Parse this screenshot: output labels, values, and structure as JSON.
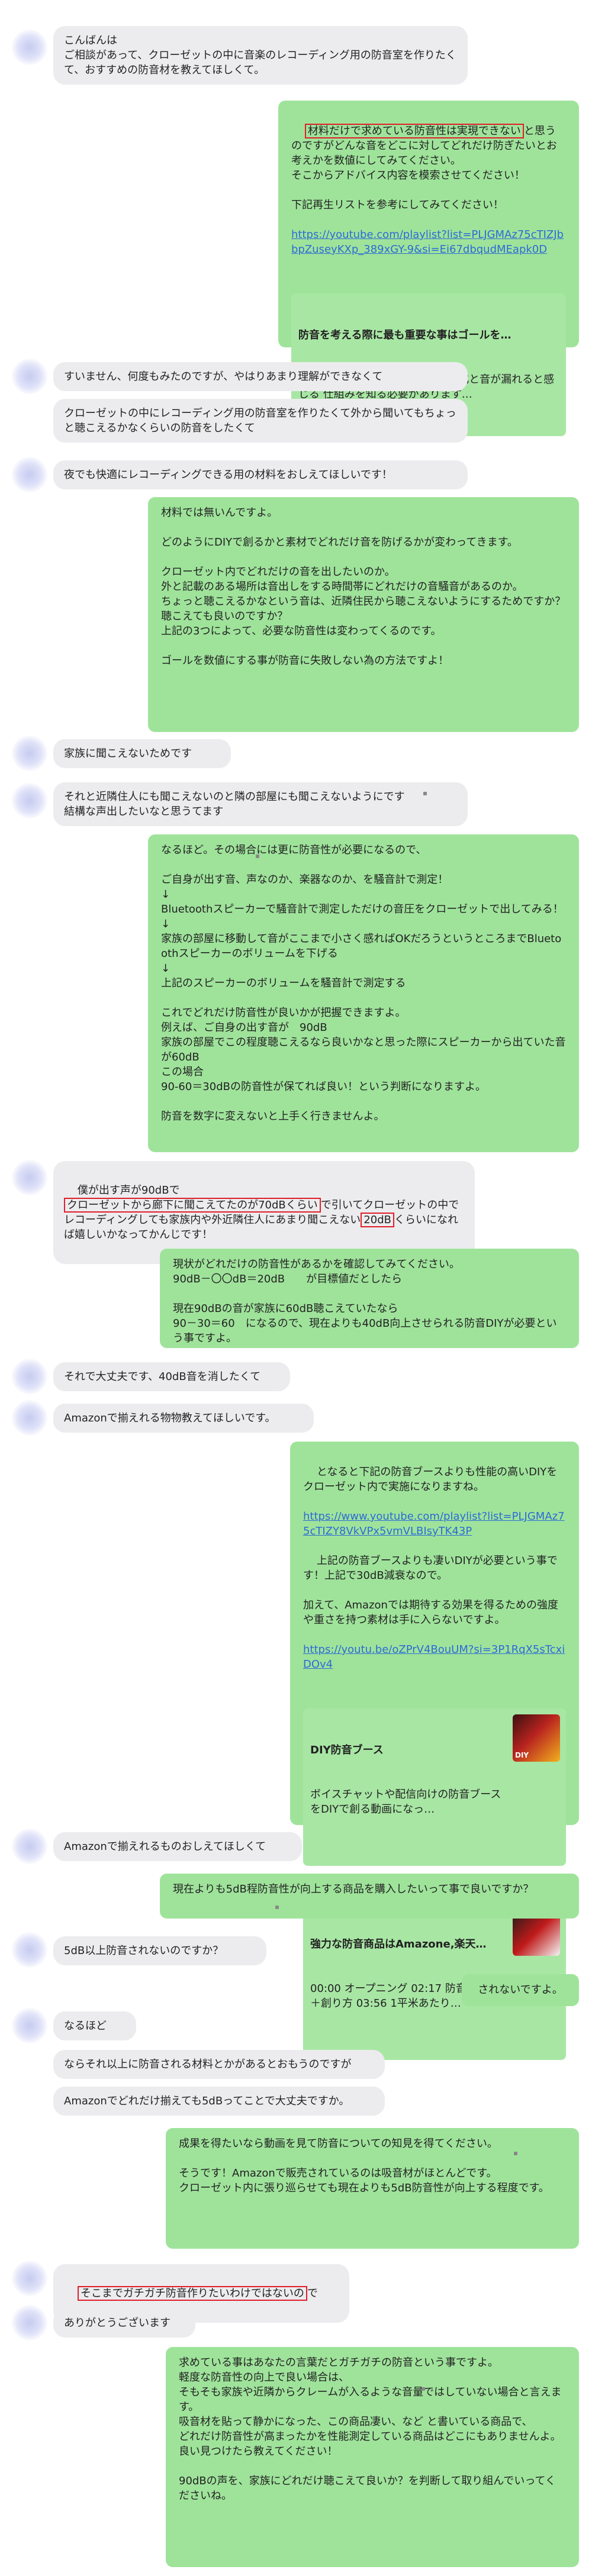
{
  "messages": [
    {
      "side": "in",
      "text": "こんばんは\nご相談があって、クローゼットの中に音楽のレコーディング用の防音室を作りたくて、おすすめの防音材を教えてほしくて。"
    },
    {
      "side": "out",
      "hl": "材料だけで求めている防音性は実現できない",
      "text": "と思うのですがどんな音をどこに対してどれだけ防ぎたいとお考えかを数値にしてみてください。\nそこからアドバイス内容を模索させてください！\n\n下記再生リストを参考にしてみてください！",
      "link": "https://youtube.com/playlist?list=PLJGMAz75cTIZJbbpZuseyKXp_389xGY-9&si=Ei67dbqudMEapk0D",
      "card": {
        "title": "防音を考える際に最も重要な事はゴールを…",
        "desc": "防音にはゴールを明確にする数値化と音が漏れると感じる 仕組みを知る必要があります…"
      }
    },
    {
      "side": "in",
      "text": "すいません、何度もみたのですが、やはりあまり理解ができなくて"
    },
    {
      "side": "in",
      "text": "クローゼットの中にレコーディング用の防音室を作りたくて外から聞いてもちょっと聴こえるかなくらいの防音をしたくて"
    },
    {
      "side": "in",
      "text": "夜でも快適にレコーディングできる用の材料をおしえてほしいです！"
    },
    {
      "side": "out",
      "text": "材料では無いんですよ。\n\nどのようにDIYで創るかと素材でどれだけ音を防げるかが変わってきます。\n\nクローゼット内でどれだけの音を出したいのか。\n外と記載のある場所は音出しをする時間帯にどれだけの音騒音があるのか。\nちょっと聴こえるかなという音は、近隣住民から聴こえないようにするためですか？\n聴こえても良いのですか？\n上記の3つによって、必要な防音性は変わってくるのです。\n\nゴールを数値にする事が防音に失敗しない為の方法ですよ！"
    },
    {
      "side": "in",
      "text": "家族に聞こえないためです"
    },
    {
      "side": "in",
      "text": "それと近隣住人にも聞こえないのと隣の部屋にも聞こえないようにです\n結構な声出したいなと思うてます"
    },
    {
      "side": "out",
      "text": "なるほど。その場合には更に防音性が必要になるので、\n\nご自身が出す音、声なのか、楽器なのか、を騒音計で測定！\n↓\nBluetoothスピーカーで騒音計で測定しただけの音圧をクローゼットで出してみる！\n↓\n家族の部屋に移動して音がここまで小さく感ればOKだろうというところまでBluetoothスピーカーのボリュームを下げる\n↓\n上記のスピーカーのボリュームを騒音計で測定する\n\nこれでどれだけ防音性が良いかが把握できますよ。\n例えば、ご自身の出す音が　90dB\n家族の部屋でこの程度聴こえるなら良いかなと思った際にスピーカーから出ていた音が60dB\nこの場合\n90-60＝30dBの防音性が保てれば良い！という判断になりますよ。\n\n防音を数字に変えないと上手く行きませんよ。"
    },
    {
      "side": "in",
      "parts": [
        {
          "t": "僕が出す声が90dBで\n"
        },
        {
          "t": "クローゼットから廊下に聞こえてたのが70dBくらい",
          "hl": true
        },
        {
          "t": "で引いてクローゼットの中でレコーディングしても家族内や外近隣住人にあまり聞こえない"
        },
        {
          "t": "20dB",
          "hl": true
        },
        {
          "t": "くらいになれば嬉しいかなってかんじです！"
        }
      ]
    },
    {
      "side": "out",
      "text": "現状がどれだけの防音性があるかを確認してみてください。\n90dB－〇〇dB＝20dB　　が目標値だとしたら\n\n現在90dBの音が家族に60dB聴こえていたなら\n90－30＝60　になるので、現在よりも40dB向上させられる防音DIYが必要という事ですよ。"
    },
    {
      "side": "in",
      "text": "それで大丈夫です、40dB音を消したくて"
    },
    {
      "side": "in",
      "text": "Amazonで揃えれる物物教えてほしいです。"
    },
    {
      "side": "out",
      "text": "となると下記の防音ブースよりも性能の高いDIYをクローゼット内で実施になりますね。",
      "link": "https://www.youtube.com/playlist?list=PLJGMAz75cTIZY8VkVPx5vmVLBIsyTK43P",
      "text2": "上記の防音ブースよりも凄いDIYが必要という事です！上記で30dB減衰なので。\n\n加えて、Amazonでは期待する効果を得るための強度や重さを持つ素材は手に入らないですよ。",
      "link2": "https://youtu.be/oZPrV4BouUM?si=3P1RqX5sTcxiDOv4",
      "cards": [
        {
          "title": "DIY防音ブース",
          "desc": "ボイスチャットや配信向けの防音ブースをDIYで創る動画になっ…",
          "thumb": "DIY"
        },
        {
          "title": "強力な防音商品はAmazone,楽天…",
          "desc": "00:00 オープニング 02:17 防音は重さ＋創り方 03:56 1平米あたり…",
          "thumb": ""
        }
      ]
    },
    {
      "side": "in",
      "text": "Amazonで揃えれるものおしえてほしくて"
    },
    {
      "side": "out",
      "text": "現在よりも5dB程防音性が向上する商品を購入したいって事で良いですか？"
    },
    {
      "side": "in",
      "text": "5dB以上防音されないのですか？"
    },
    {
      "side": "out",
      "text": "されないですよ。"
    },
    {
      "side": "in",
      "text": "なるほど"
    },
    {
      "side": "in",
      "text": "ならそれ以上に防音される材料とかがあるとおもうのですが"
    },
    {
      "side": "in",
      "text": "Amazonでどれだけ揃えても5dBってことで大丈夫ですか。"
    },
    {
      "side": "out",
      "text": "成果を得たいなら動画を見て防音についての知見を得てください。\n\nそうです！Amazonで販売されているのは吸音材がほとんどです。\nクローゼット内に張り巡らせても現在よりも5dB防音性が向上する程度です。"
    },
    {
      "side": "in",
      "parts": [
        {
          "t": "そこまでガチガチ防音作りたいわけではないの",
          "hl": true
        },
        {
          "t": "で"
        }
      ]
    },
    {
      "side": "in",
      "text": "ありがとうございます"
    },
    {
      "side": "out",
      "text": "求めている事はあなたの言葉だとガチガチの防音という事ですよ。\n軽度な防音性の向上で良い場合は、\nそもそも家族や近隣からクレームが入るような音量ではしていない場合と言えます。\n吸音材を貼って静かになった、この商品凄い、など と書いている商品で、\nどれだけ防音性が高まったかを性能測定している商品はどこにもありませんよ。\n良い見つけたら教えてください！\n\n90dBの声を、家族にどれだけ聴こえて良いか？を判断して取り組んでいってくださいね。"
    }
  ]
}
